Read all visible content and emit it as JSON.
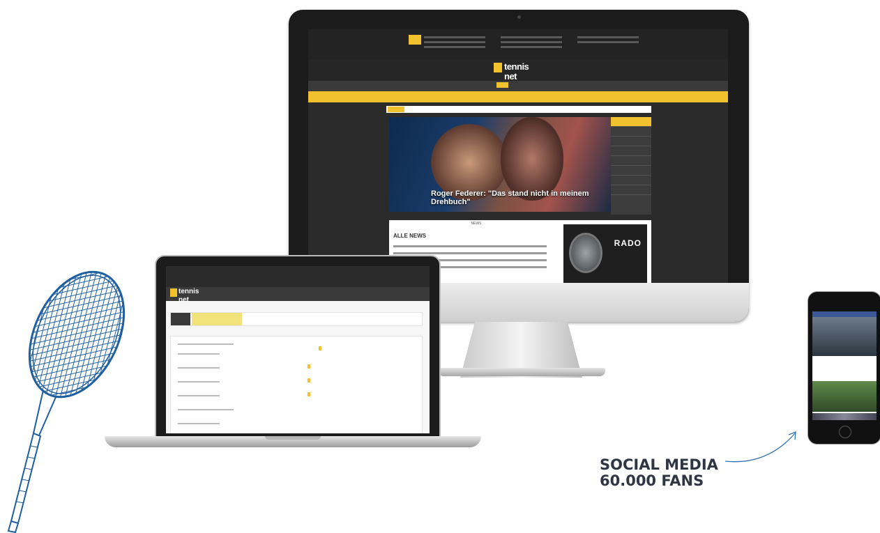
{
  "desktop": {
    "site_logo_line1": "tennis",
    "site_logo_line2": "net",
    "hero_caption": "Roger Federer: \"Das stand nicht in meinem Drehbuch\"",
    "news_heading": "NEWS",
    "all_news_label": "ALLE NEWS",
    "ad_brand": "RADO"
  },
  "laptop": {
    "site_logo_line1": "tennis",
    "site_logo_line2": "net"
  },
  "callout": {
    "line1": "SOCIAL MEDIA",
    "line2": "60.000 FANS"
  },
  "colors": {
    "accent": "#f2c12e",
    "text": "#2f3542",
    "racket": "#1f5fa0",
    "arrow": "#2f6fb0"
  },
  "icons": [
    "tennis-racket-icon",
    "curved-arrow-icon"
  ]
}
